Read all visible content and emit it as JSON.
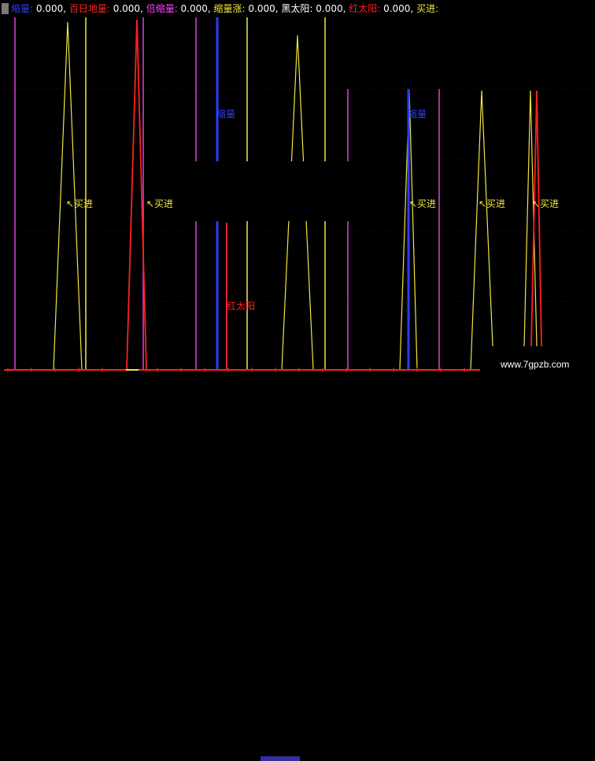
{
  "header": {
    "items": [
      {
        "label": "缩量:",
        "value": "0.000,",
        "color": "#2a3cff"
      },
      {
        "label": "百日地量:",
        "value": "0.000,",
        "color": "#ff2020"
      },
      {
        "label": "倍缩量:",
        "value": "0.000,",
        "color": "#ff40ff"
      },
      {
        "label": "缩量涨:",
        "value": "0.000,",
        "color": "#f2e640"
      },
      {
        "label": "黑太阳:",
        "value": "0.000,",
        "color": "#ffffff"
      },
      {
        "label": "红太阳:",
        "value": "0.000,",
        "color": "#ff2020"
      },
      {
        "label": "买进:",
        "value": "",
        "color": "#f2e640"
      }
    ]
  },
  "labels": {
    "buy": "↖买进",
    "shrink": "缩量",
    "red_sun": "红太阳"
  },
  "watermark": "www.7gpzb.com",
  "colors": {
    "background": "#000000",
    "yellow": "#f2e640",
    "red": "#ff2020",
    "magenta": "#ff40ff",
    "blue": "#2a3cff",
    "grid": "#3a0000"
  }
}
